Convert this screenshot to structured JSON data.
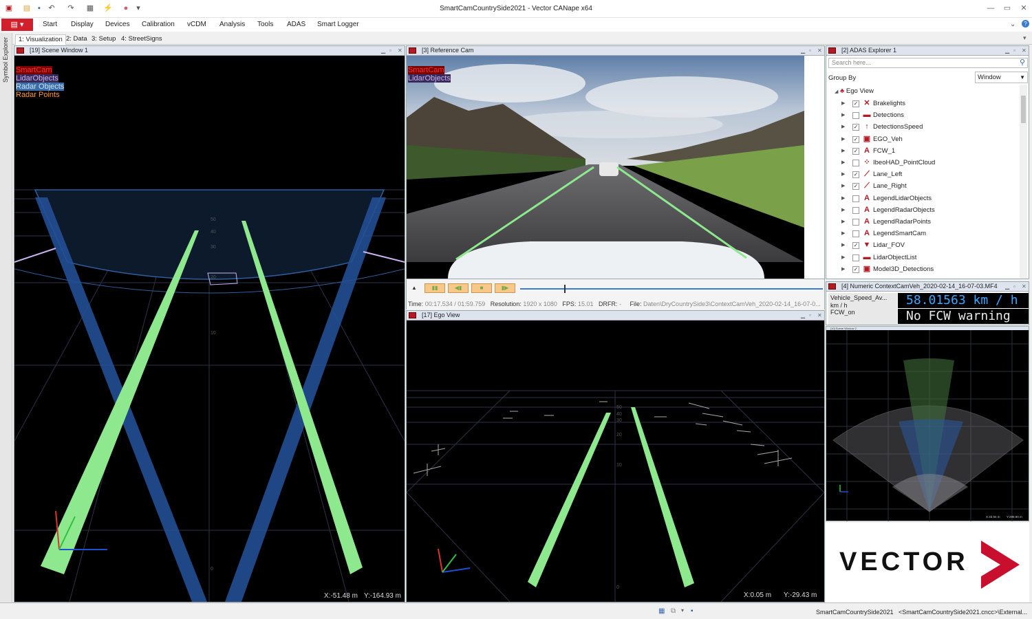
{
  "window": {
    "title": "SmartCamCountrySide2021 - Vector CANape x64",
    "controls": [
      "—",
      "▭",
      "✕"
    ]
  },
  "menu": {
    "items": [
      "Start",
      "Display",
      "Devices",
      "Calibration",
      "vCDM",
      "Analysis",
      "Tools",
      "ADAS",
      "Smart Logger"
    ]
  },
  "tabs": [
    "1: Visualization",
    "2: Data",
    "3: Setup",
    "4: StreetSigns"
  ],
  "side_strip": "Symbol Explorer",
  "scene_window": {
    "title": "[19] Scene Window 1",
    "legend": [
      {
        "label": "SmartCam",
        "color": "#ff3030",
        "bg": "#7a0000"
      },
      {
        "label": "LidarObjects",
        "color": "#c9b3f0",
        "bg": "#3a2a5a"
      },
      {
        "label": "Radar Objects",
        "color": "#cfe6ff",
        "bg": "#3b6ea8"
      },
      {
        "label": "Radar Points",
        "color": "#ff9a2a",
        "bg": ""
      }
    ],
    "distance_labels": [
      "50",
      "40",
      "30",
      "20",
      "10",
      "0"
    ],
    "coord_x": "X:-51.48 m",
    "coord_y": "Y:-164.93 m"
  },
  "reference_cam": {
    "title": "[3] Reference Cam",
    "legend": [
      {
        "label": "SmartCam",
        "color": "#ff3030",
        "bg": "#7a0000"
      },
      {
        "label": "LidarObjects",
        "color": "#c9b3f0",
        "bg": "#3a2a5a"
      }
    ],
    "time_label": "Time:",
    "time_value": "00:17.534 / 01:59.759",
    "resolution_label": "Resolution:",
    "resolution_value": "1920 x 1080",
    "fps_label": "FPS:",
    "fps_value": "15.01",
    "drfr_label": "DRFR:",
    "drfr_value": "-",
    "file_label": "File:",
    "file_value": "Daten\\DryCountrySide3\\ContextCamVeh_2020-02-14_16-07-0...",
    "playback_progress": 0.146
  },
  "ego_view": {
    "title": "[17] Ego View",
    "distance_labels": [
      "50",
      "40",
      "30",
      "20",
      "10",
      "0"
    ],
    "coord_x": "X:0.05 m",
    "coord_y": "Y:-29.43 m"
  },
  "adas_explorer": {
    "title": "[2] ADAS Explorer 1",
    "search_placeholder": "Search here...",
    "group_by_label": "Group By",
    "group_by_value": "Window",
    "root": "Ego View",
    "items": [
      {
        "label": "Brakelights",
        "checked": true,
        "icon": "✕"
      },
      {
        "label": "Detections",
        "checked": false,
        "icon": "▬"
      },
      {
        "label": "DetectionsSpeed",
        "checked": true,
        "icon": "↑"
      },
      {
        "label": "EGO_Veh",
        "checked": true,
        "icon": "▣"
      },
      {
        "label": "FCW_1",
        "checked": true,
        "icon": "A"
      },
      {
        "label": "IbeoHAD_PointCloud",
        "checked": false,
        "icon": "⁘"
      },
      {
        "label": "Lane_Left",
        "checked": true,
        "icon": "⟋"
      },
      {
        "label": "Lane_Right",
        "checked": true,
        "icon": "⟋"
      },
      {
        "label": "LegendLidarObjects",
        "checked": false,
        "icon": "A"
      },
      {
        "label": "LegendRadarObjects",
        "checked": false,
        "icon": "A"
      },
      {
        "label": "LegendRadarPoints",
        "checked": false,
        "icon": "A"
      },
      {
        "label": "LegendSmartCam",
        "checked": false,
        "icon": "A"
      },
      {
        "label": "Lidar_FOV",
        "checked": true,
        "icon": "▼"
      },
      {
        "label": "LidarObjectList",
        "checked": false,
        "icon": "▬"
      },
      {
        "label": "Model3D_Detections",
        "checked": true,
        "icon": "▣"
      }
    ]
  },
  "numeric": {
    "title": "[4] Numeric ContextCamVeh_2020-02-14_16-07-03.MF4",
    "label1": "Vehicle_Speed_Av...",
    "unit1": "km / h",
    "label2": "FCW_on",
    "value1": "58.01563 km / h",
    "value2": "No FCW warning",
    "value1_color": "#3ea6ff",
    "value2_color": "#e8e8e8"
  },
  "mini_scene": {
    "title": "[10] Scene Window 2",
    "coord_x": "X:33.94 m",
    "coord_y": "Y:298.90 m"
  },
  "logo_text": "VECTOR",
  "status": {
    "project": "SmartCamCountrySide2021",
    "config": "<SmartCamCountrySide2021.cncc>\\External..."
  },
  "colors": {
    "lane": "#8ee88e",
    "brand": "#c8102e",
    "radar_beam": "#2a5aa0"
  }
}
